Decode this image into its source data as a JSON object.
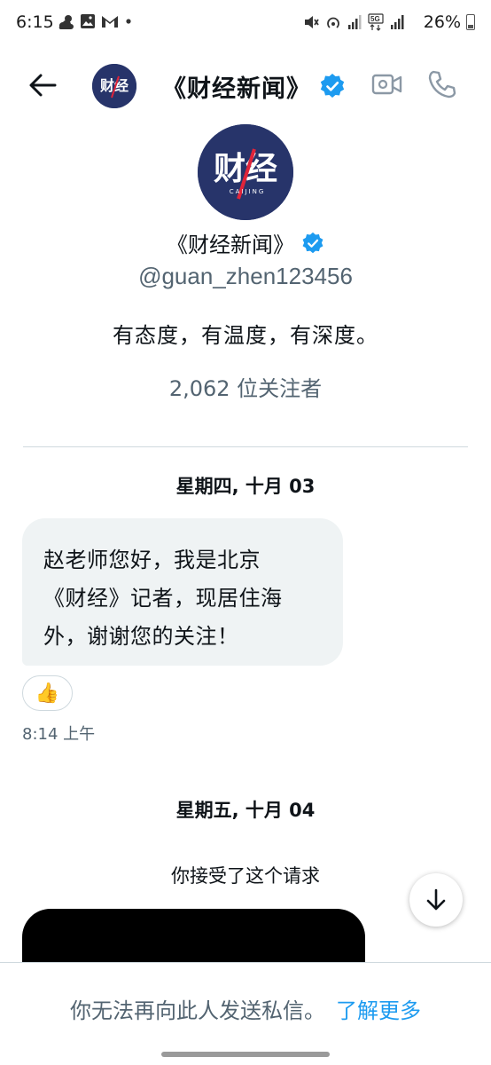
{
  "status_bar": {
    "time": "6:15",
    "battery": "26%",
    "left_icons": [
      "weather-icon",
      "gallery-icon",
      "gmail-icon",
      "dot-icon"
    ],
    "right_icons": [
      "mute-icon",
      "hotspot-icon",
      "signal-icon",
      "5g-icon",
      "signal-icon"
    ]
  },
  "header": {
    "title": "《财经新闻》",
    "verified": true,
    "avatar_logo": "财经",
    "avatar_sub": "CAIJING"
  },
  "profile": {
    "logo_text": "财经",
    "logo_sub": "CAIJING",
    "name": "《财经新闻》",
    "handle": "@guan_zhen123456",
    "bio": "有态度，有温度，有深度。",
    "followers": "2,062 位关注者"
  },
  "chat": {
    "day1": "星期四, 十月 03",
    "message1_lines": [
      "赵老师您好，我是北京",
      "《财经》记者，现居住海",
      "外，谢谢您的关注！"
    ],
    "reaction": "👍",
    "message1_time": "8:14 上午",
    "day2": "星期五, 十月 04",
    "system_note": "你接受了这个请求"
  },
  "footer": {
    "text": "你无法再向此人发送私信。",
    "link": "了解更多"
  },
  "colors": {
    "brand_navy": "#27346a",
    "accent_red": "#e0243a",
    "verified_blue": "#1d9bf0",
    "secondary_text": "#536471",
    "bubble": "#eff3f4"
  }
}
